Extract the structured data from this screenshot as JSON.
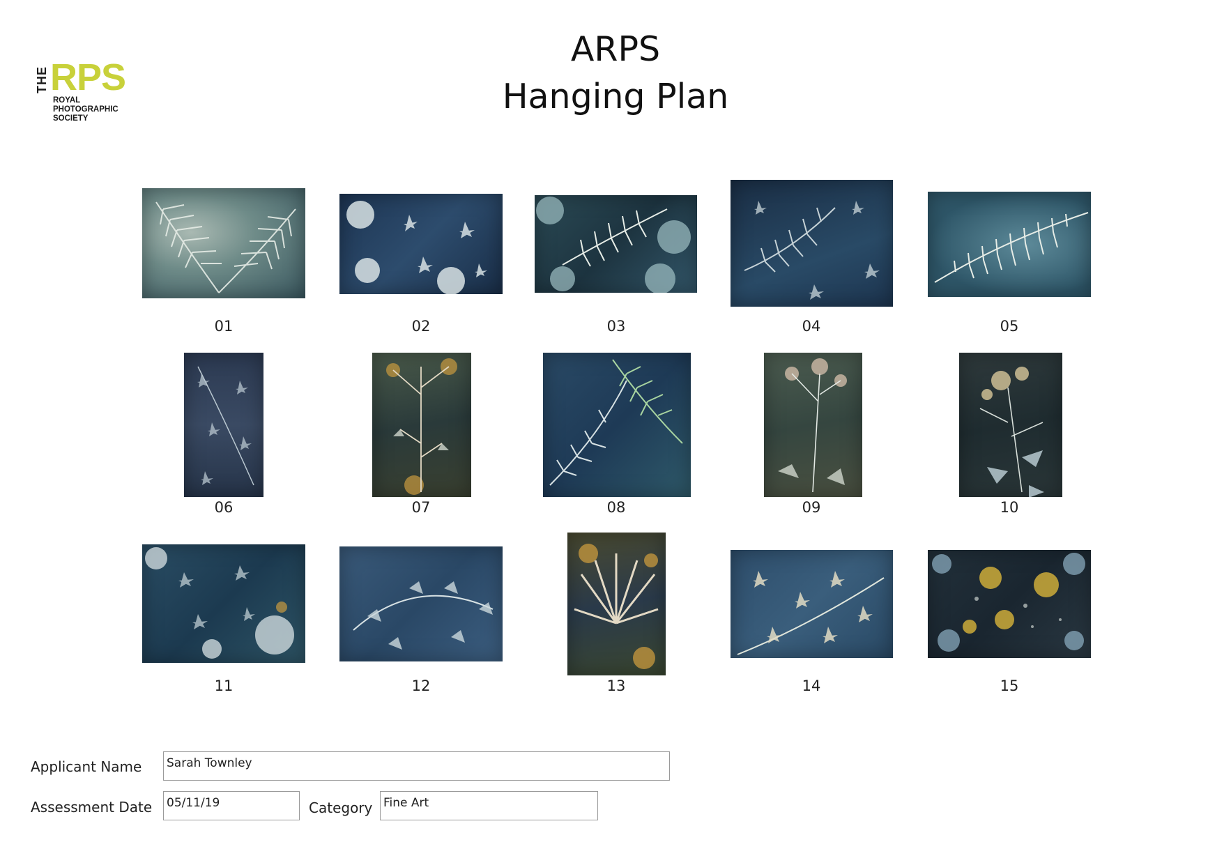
{
  "logo": {
    "the": "THE",
    "rps": "RPS",
    "line1": "ROYAL",
    "line2": "PHOTOGRAPHIC",
    "line3": "SOCIETY"
  },
  "header": {
    "title": "ARPS",
    "subtitle": "Hanging Plan"
  },
  "images": [
    {
      "label": "01",
      "icon": "fern-cyanotype-image"
    },
    {
      "label": "02",
      "icon": "leaves-cyanotype-image"
    },
    {
      "label": "03",
      "icon": "fern-cyanotype-image"
    },
    {
      "label": "04",
      "icon": "fern-cyanotype-image"
    },
    {
      "label": "05",
      "icon": "fern-cyanotype-image"
    },
    {
      "label": "06",
      "icon": "leaves-cyanotype-image"
    },
    {
      "label": "07",
      "icon": "flower-cyanotype-image"
    },
    {
      "label": "08",
      "icon": "fern-cyanotype-image"
    },
    {
      "label": "09",
      "icon": "flower-cyanotype-image"
    },
    {
      "label": "10",
      "icon": "flower-cyanotype-image"
    },
    {
      "label": "11",
      "icon": "leaves-cyanotype-image"
    },
    {
      "label": "12",
      "icon": "leaves-cyanotype-image"
    },
    {
      "label": "13",
      "icon": "leaves-cyanotype-image"
    },
    {
      "label": "14",
      "icon": "leaves-cyanotype-image"
    },
    {
      "label": "15",
      "icon": "abstract-cyanotype-image"
    }
  ],
  "form": {
    "applicant_label": "Applicant Name",
    "applicant_value": "Sarah Townley",
    "date_label": "Assessment Date",
    "date_value": "05/11/19",
    "category_label": "Category",
    "category_value": "Fine Art"
  },
  "colors": {
    "brand": "#c8d13a",
    "cyan_dark": "#1f3a52",
    "cyan_mid": "#3f6f84",
    "pale": "#d8e2dd",
    "ochre": "#c99a3e"
  }
}
